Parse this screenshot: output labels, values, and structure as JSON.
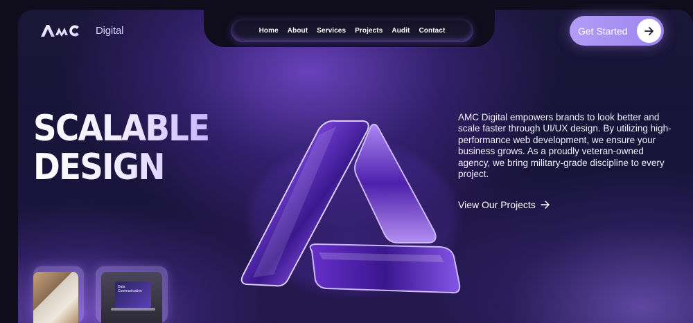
{
  "brand": {
    "logo_mark": "AMC",
    "logo_suffix": "Digital"
  },
  "nav": {
    "items": [
      "Home",
      "About",
      "Services",
      "Projects",
      "Audit",
      "Contact"
    ]
  },
  "cta": {
    "label": "Get Started",
    "icon": "arrow-right-icon"
  },
  "hero": {
    "headline_line1": "SCALABLE",
    "headline_line2": "DESIGN",
    "description": "AMC Digital empowers brands to look better and scale faster through UI/UX design. By utilizing high-performance web development, we ensure your business grows. As a proudly veteran-owned agency, we bring military-grade discipline to every project.",
    "link_label": "View Our Projects",
    "link_icon": "arrow-right-icon"
  },
  "thumbnails": {
    "laptop_screen_text": "Data Communication"
  },
  "colors": {
    "background": "#0f0d1c",
    "accent": "#9e84ef",
    "glow": "#7d4ee0"
  }
}
